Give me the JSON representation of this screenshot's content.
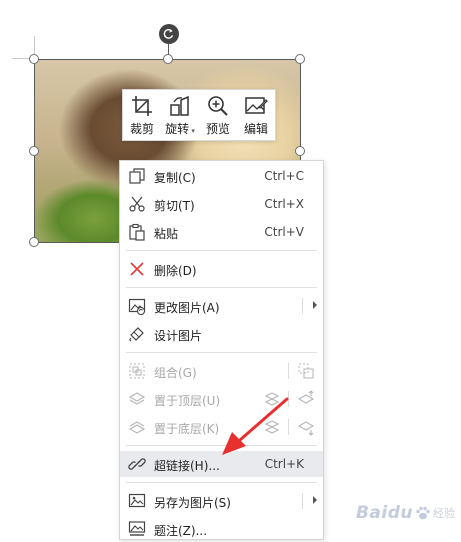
{
  "toolbar": {
    "items": [
      {
        "label": "裁剪",
        "icon": "crop-icon"
      },
      {
        "label": "旋转",
        "icon": "rotate-icon",
        "dropdown": true
      },
      {
        "label": "预览",
        "icon": "zoom-in-icon"
      },
      {
        "label": "编辑",
        "icon": "edit-image-icon"
      }
    ]
  },
  "menu": {
    "items": [
      {
        "label": "复制(C)",
        "shortcut": "Ctrl+C",
        "icon": "copy-icon"
      },
      {
        "label": "剪切(T)",
        "shortcut": "Ctrl+X",
        "icon": "scissors-icon"
      },
      {
        "label": "粘贴",
        "shortcut": "Ctrl+V",
        "icon": "paste-icon"
      },
      {
        "label": "删除(D)",
        "icon": "delete-x-icon"
      },
      {
        "label": "更改图片(A)",
        "icon": "change-picture-icon",
        "submenu": true
      },
      {
        "label": "设计图片",
        "icon": "design-picture-icon"
      },
      {
        "label": "组合(G)",
        "icon": "group-icon",
        "disabled": true
      },
      {
        "label": "置于顶层(U)",
        "icon": "bring-front-icon",
        "disabled": true
      },
      {
        "label": "置于底层(K)",
        "icon": "send-back-icon",
        "disabled": true
      },
      {
        "label": "超链接(H)...",
        "shortcut": "Ctrl+K",
        "icon": "link-icon",
        "highlighted": true
      },
      {
        "label": "另存为图片(S)",
        "icon": "save-as-picture-icon",
        "submenu": true
      },
      {
        "label": "题注(Z)...",
        "icon": "caption-icon"
      }
    ]
  },
  "colors": {
    "delete_icon": "#e23b3b",
    "annotation_arrow": "#e8312f",
    "highlight_row": "#e8eaee"
  },
  "watermark": {
    "brand": "Baidu",
    "sub": "经验"
  }
}
